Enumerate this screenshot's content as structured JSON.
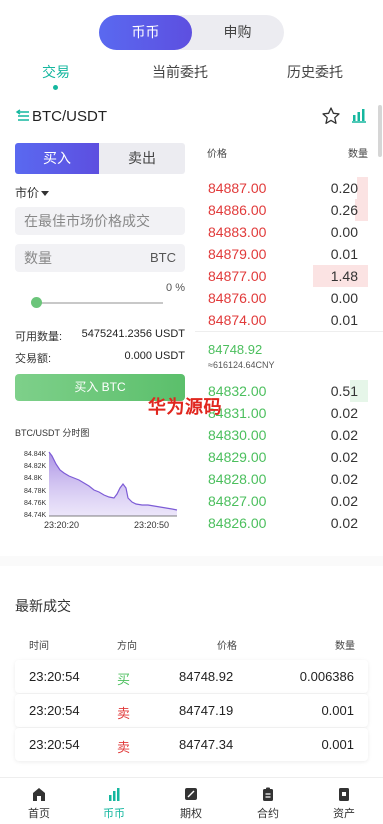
{
  "segment": {
    "active": "币币",
    "inactive": "申购"
  },
  "tabs": [
    {
      "label": "交易"
    },
    {
      "label": "当前委托"
    },
    {
      "label": "历史委托"
    }
  ],
  "pair": "BTC/USDT",
  "trade_form": {
    "buy_tab": "买入",
    "sell_tab": "卖出",
    "order_type": "市价",
    "price_placeholder": "在最佳市场价格成交",
    "amount_placeholder": "数量",
    "amount_unit": "BTC",
    "percent": "0 %",
    "percent_value": 0,
    "available_label": "可用数量:",
    "available_value": "5475241.2356 USDT",
    "volume_label": "交易额:",
    "volume_value": "0.000 USDT",
    "submit_label": "买入 BTC"
  },
  "mini_chart": {
    "title": "BTC/USDT 分时图",
    "y_ticks": [
      "84.84K",
      "84.82K",
      "84.8K",
      "84.78K",
      "84.76K",
      "84.74K"
    ],
    "x_ticks": [
      "23:20:20",
      "23:20:50"
    ]
  },
  "order_book": {
    "price_header": "价格",
    "qty_header": "数量",
    "asks": [
      {
        "price": "84887.00",
        "qty": "0.20",
        "depth": 0.2
      },
      {
        "price": "84886.00",
        "qty": "0.26",
        "depth": 0.24
      },
      {
        "price": "84883.00",
        "qty": "0.00",
        "depth": 0
      },
      {
        "price": "84879.00",
        "qty": "0.01",
        "depth": 0
      },
      {
        "price": "84877.00",
        "qty": "1.48",
        "depth": 1
      },
      {
        "price": "84876.00",
        "qty": "0.00",
        "depth": 0
      },
      {
        "price": "84874.00",
        "qty": "0.01",
        "depth": 0
      }
    ],
    "last_price": "84748.92",
    "last_price_cny": "≈616124.64CNY",
    "bids": [
      {
        "price": "84832.00",
        "qty": "0.51",
        "depth": 0.33
      },
      {
        "price": "84831.00",
        "qty": "0.02",
        "depth": 0
      },
      {
        "price": "84830.00",
        "qty": "0.02",
        "depth": 0
      },
      {
        "price": "84829.00",
        "qty": "0.02",
        "depth": 0
      },
      {
        "price": "84828.00",
        "qty": "0.02",
        "depth": 0
      },
      {
        "price": "84827.00",
        "qty": "0.02",
        "depth": 0
      },
      {
        "price": "84826.00",
        "qty": "0.02",
        "depth": 0
      }
    ]
  },
  "watermark": "华为源码",
  "latest_trades": {
    "title": "最新成交",
    "headers": {
      "time": "时间",
      "direction": "方向",
      "price": "价格",
      "qty": "数量"
    },
    "rows": [
      {
        "time": "23:20:54",
        "direction": "买",
        "side": "buy",
        "price": "84748.92",
        "qty": "0.006386"
      },
      {
        "time": "23:20:54",
        "direction": "卖",
        "side": "sell",
        "price": "84747.19",
        "qty": "0.001"
      },
      {
        "time": "23:20:54",
        "direction": "卖",
        "side": "sell",
        "price": "84747.34",
        "qty": "0.001"
      }
    ]
  },
  "bottom_nav": [
    {
      "label": "首页",
      "icon": "home-icon"
    },
    {
      "label": "币币",
      "icon": "bar-chart-icon"
    },
    {
      "label": "期权",
      "icon": "options-icon"
    },
    {
      "label": "合约",
      "icon": "contract-icon"
    },
    {
      "label": "资产",
      "icon": "wallet-icon"
    }
  ],
  "colors": {
    "accent": "#15b79f",
    "primary": "#5a69f0",
    "ask": "#e13a3a",
    "bid": "#4bbf5d"
  }
}
